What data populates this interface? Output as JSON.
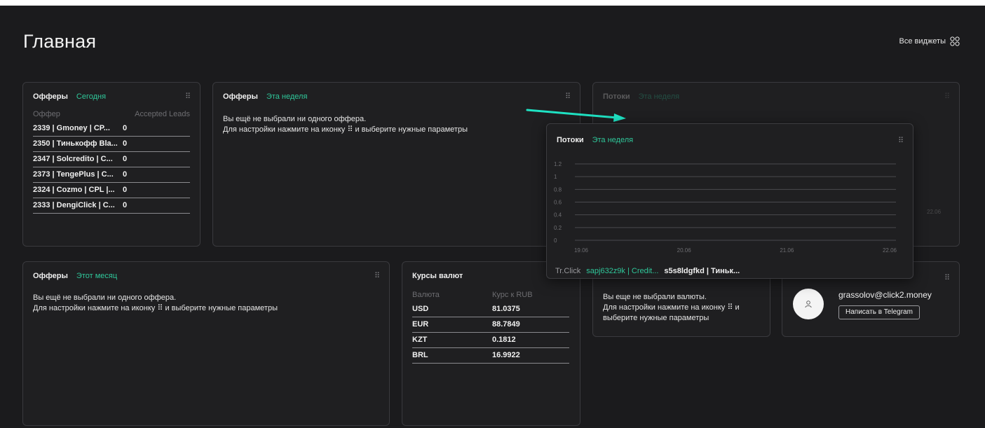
{
  "page": {
    "title": "Главная",
    "all_widgets": "Все виджеты"
  },
  "colors": {
    "accent": "#2fc79a",
    "background": "#1b1b1d",
    "card": "#1f1f21"
  },
  "offers_today": {
    "title": "Офферы",
    "period": "Сегодня",
    "columns": [
      "Оффер",
      "Accepted Leads"
    ],
    "rows": [
      {
        "offer": "2339 | Gmoney | CP...",
        "leads": "0"
      },
      {
        "offer": "2350 | Тинькофф Bla...",
        "leads": "0"
      },
      {
        "offer": "2347 | Solcredito | C...",
        "leads": "0"
      },
      {
        "offer": "2373 | TengePlus | C...",
        "leads": "0"
      },
      {
        "offer": "2324 | Cozmo | CPL |...",
        "leads": "0"
      },
      {
        "offer": "2333 | DengiClick | C...",
        "leads": "0"
      }
    ]
  },
  "offers_week": {
    "title": "Офферы",
    "period": "Эта неделя",
    "line1": "Вы ещё не выбрали ни одного оффера.",
    "line2": "Для настройки нажмите на иконку ⠿ и выберите нужные параметры"
  },
  "streams_bg": {
    "title": "Потоки",
    "period": "Эта неделя",
    "tick": "22.06"
  },
  "streams_popup": {
    "title": "Потоки",
    "period": "Эта неделя",
    "footer": {
      "label": "Tr.Click",
      "stream1": "sapj632z9k | Credit...",
      "stream2": "s5s8ldgfkd | Тиньк..."
    }
  },
  "chart_data": {
    "type": "line",
    "x": [
      "19.06",
      "20.06",
      "21.06",
      "22.06"
    ],
    "series": [],
    "yticks": [
      "1.2",
      "1",
      "0.8",
      "0.6",
      "0.4",
      "0.2",
      "0"
    ],
    "ylim": [
      0,
      1.2
    ],
    "grid": true
  },
  "offers_month": {
    "title": "Офферы",
    "period": "Этот месяц",
    "line1": "Вы ещё не выбрали ни одного оффера.",
    "line2": "Для настройки нажмите на иконку ⠿ и выберите нужные параметры"
  },
  "currency": {
    "title": "Курсы валют",
    "columns": [
      "Валюта",
      "Курс к RUB"
    ],
    "rows": [
      {
        "code": "USD",
        "rate": "81.0375"
      },
      {
        "code": "EUR",
        "rate": "88.7849"
      },
      {
        "code": "KZT",
        "rate": "0.1812"
      },
      {
        "code": "BRL",
        "rate": "16.9922"
      }
    ]
  },
  "currency_select": {
    "line1": "Вы еще не выбрали валюты.",
    "line2": "Для настройки нажмите на иконку ⠿ и",
    "line3": "выберите нужные параметры"
  },
  "manager": {
    "email": "grassolov@click2.money",
    "button": "Написать в Telegram"
  }
}
